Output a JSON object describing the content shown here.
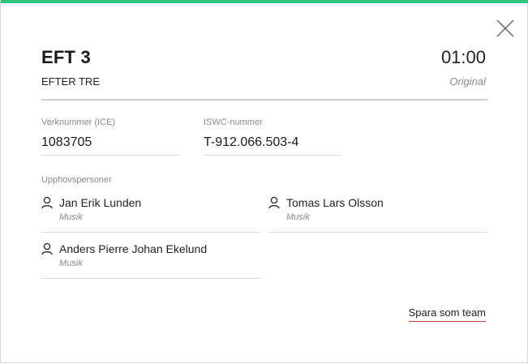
{
  "work": {
    "title": "EFT 3",
    "subtitle": "EFTER TRE",
    "duration": "01:00",
    "version": "Original"
  },
  "fields": {
    "ice_label": "Verknummer (ICE)",
    "ice_value": "1083705",
    "iswc_label": "ISWC-nummer",
    "iswc_value": "T-912.066.503-4"
  },
  "creators": {
    "section_label": "Upphovspersoner",
    "items": [
      {
        "name": "Jan Erik Lunden",
        "role": "Musik",
        "icon": "person-icon"
      },
      {
        "name": "Tomas Lars Olsson",
        "role": "Musik",
        "icon": "person-icon"
      },
      {
        "name": "Anders Pierre Johan Ekelund",
        "role": "Musik",
        "icon": "person-icon"
      }
    ]
  },
  "actions": {
    "save_team_label": "Spara som team",
    "close_icon": "close-icon"
  },
  "colors": {
    "accent": "#2fc47e",
    "link_underline": "#c0392b"
  }
}
